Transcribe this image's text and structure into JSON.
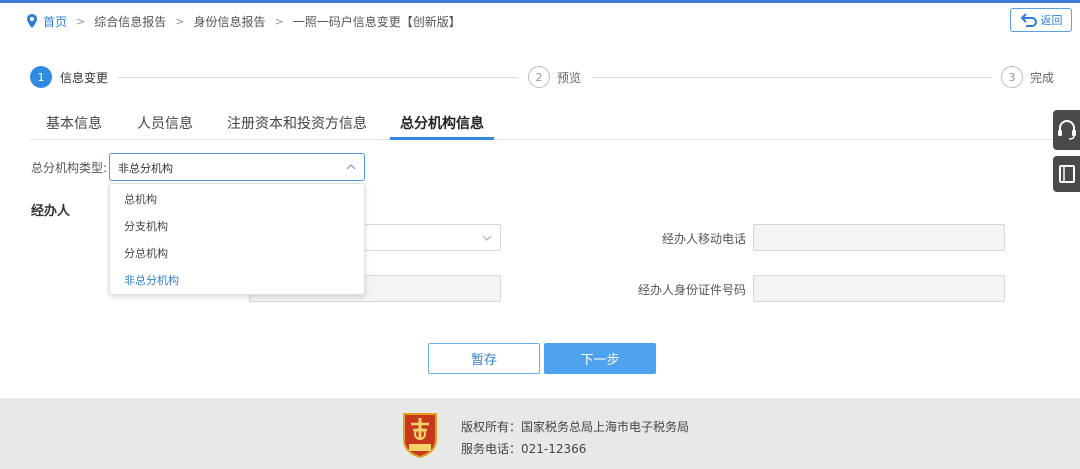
{
  "breadcrumb": {
    "home": "首页",
    "separator": ">",
    "items": [
      "综合信息报告",
      "身份信息报告",
      "一照一码户信息变更【创新版】"
    ]
  },
  "back_button": {
    "label": "返回"
  },
  "steps": [
    {
      "number": "1",
      "label": "信息变更",
      "state": "active"
    },
    {
      "number": "2",
      "label": "预览",
      "state": "todo"
    },
    {
      "number": "3",
      "label": "完成",
      "state": "todo"
    }
  ],
  "tabs": [
    {
      "label": "基本信息",
      "active": false
    },
    {
      "label": "人员信息",
      "active": false
    },
    {
      "label": "注册资本和投资方信息",
      "active": false
    },
    {
      "label": "总分机构信息",
      "active": true
    }
  ],
  "form": {
    "type_label": "总分机构类型:",
    "type_value": "非总分机构",
    "dropdown_options": [
      "总机构",
      "分支机构",
      "分总机构",
      "非总分机构"
    ],
    "selected_option": "非总分机构",
    "section_title": "经办人",
    "mobile_label": "经办人移动电话",
    "mobile_value": "",
    "id_number_label": "经办人身份证件号码",
    "id_number_value": ""
  },
  "actions": {
    "save_label": "暂存",
    "next_label": "下一步"
  },
  "footer": {
    "copyright": "版权所有：国家税务总局上海市电子税务局",
    "phone": "服务电话：021-12366"
  },
  "side_tools": [
    "headset-icon",
    "book-icon"
  ],
  "colors": {
    "accent": "#2f8ae0",
    "link": "#2f7fd4",
    "next_button": "#4fa3ee",
    "footer_bg": "#e8e8e8"
  }
}
